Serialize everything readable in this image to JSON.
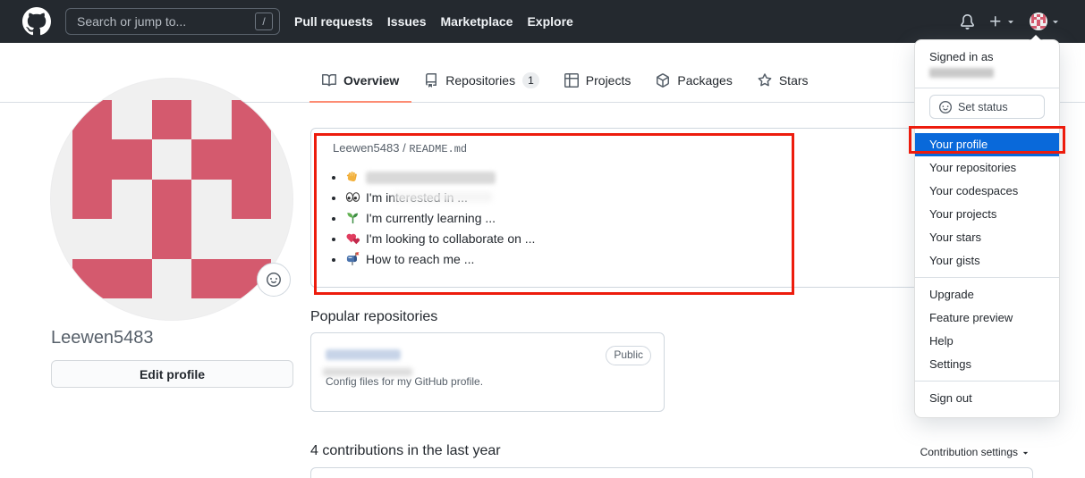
{
  "navbar": {
    "search_placeholder": "Search or jump to...",
    "search_shortcut": "/",
    "links": [
      "Pull requests",
      "Issues",
      "Marketplace",
      "Explore"
    ]
  },
  "tabs": [
    {
      "label": "Overview"
    },
    {
      "label": "Repositories",
      "count": "1"
    },
    {
      "label": "Projects"
    },
    {
      "label": "Packages"
    },
    {
      "label": "Stars"
    }
  ],
  "profile": {
    "username": "Leewen5483",
    "edit_button": "Edit profile"
  },
  "readme": {
    "header_user": "Leewen5483",
    "header_sep": " / ",
    "header_file": "README.md",
    "bullets": [
      {
        "icon": "wave-emoji",
        "text": ""
      },
      {
        "icon": "eyes-emoji",
        "text": "I'm interested in ..."
      },
      {
        "icon": "seedling-emoji",
        "text": "I'm currently learning ..."
      },
      {
        "icon": "hearts-emoji",
        "text": "I'm looking to collaborate on ..."
      },
      {
        "icon": "mailbox-emoji",
        "text": "How to reach me ..."
      }
    ]
  },
  "popular": {
    "heading": "Popular repositories",
    "repo": {
      "visibility": "Public",
      "description": "Config files for my GitHub profile."
    }
  },
  "contributions": {
    "heading": "4 contributions in the last year",
    "settings_label": "Contribution settings"
  },
  "menu": {
    "signed_in_as": "Signed in as",
    "set_status": "Set status",
    "items_top": [
      "Your profile",
      "Your repositories",
      "Your codespaces",
      "Your projects",
      "Your stars",
      "Your gists"
    ],
    "items_mid": [
      "Upgrade",
      "Feature preview",
      "Help",
      "Settings"
    ],
    "sign_out": "Sign out"
  },
  "avatar": {
    "pattern": [
      "10101",
      "11011",
      "10101",
      "00100",
      "11011"
    ],
    "fg": "#d45a6e",
    "bg": "#f0f0f0"
  },
  "colors": {
    "annotation_red": "#ed1c0d",
    "menu_highlight_blue": "#0969da",
    "active_tab_underline": "#fd8c73",
    "header_background": "#24292f"
  }
}
